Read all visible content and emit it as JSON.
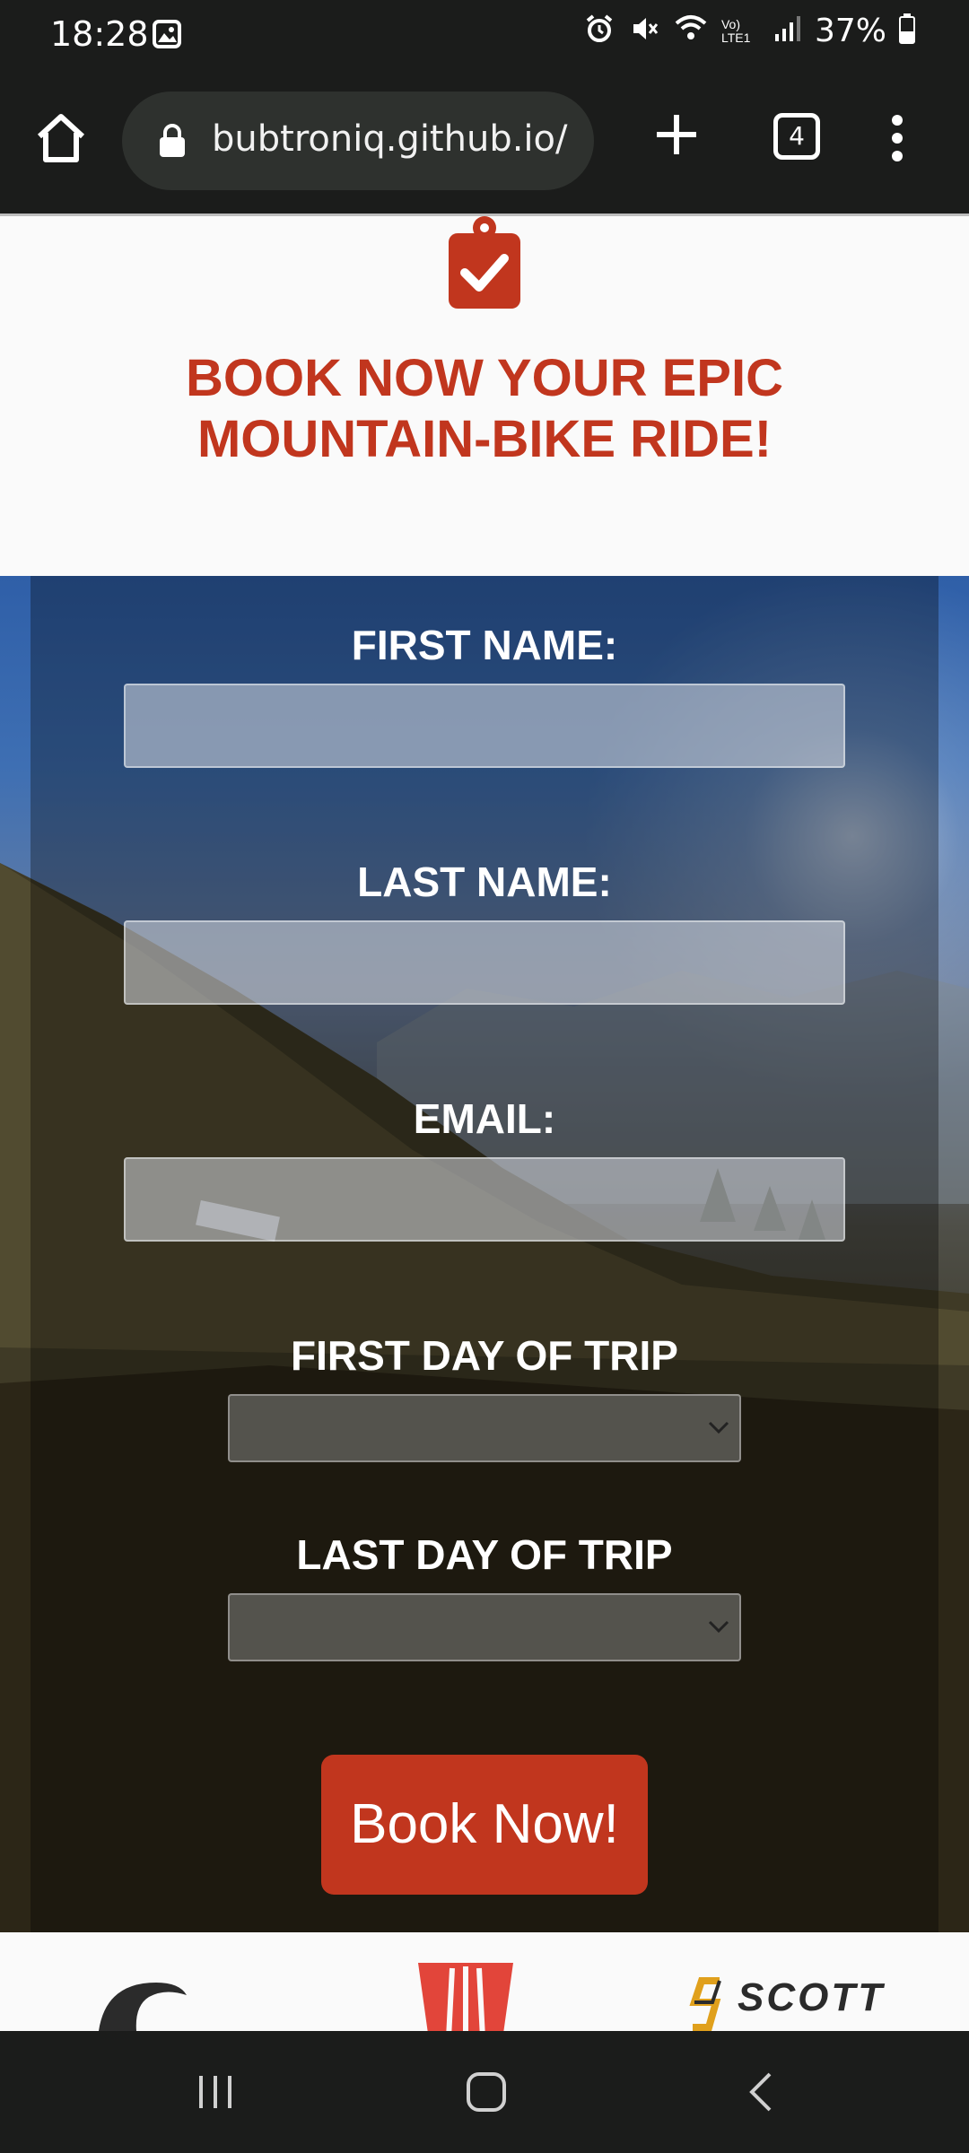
{
  "status_bar": {
    "time": "18:28",
    "battery": "37%",
    "network_label": "Vo) LTE1"
  },
  "browser": {
    "url": "bubtroniq.github.io/",
    "tab_count": "4"
  },
  "page": {
    "headline": "BOOK NOW YOUR EPIC MOUNTAIN-BIKE RIDE!",
    "accent_color": "#c1361e",
    "form": {
      "first_name_label": "FIRST NAME:",
      "first_name_value": "",
      "last_name_label": "LAST NAME:",
      "last_name_value": "",
      "email_label": "EMAIL:",
      "email_value": "",
      "first_day_label": "FIRST DAY OF TRIP",
      "first_day_value": "",
      "last_day_label": "LAST DAY OF TRIP",
      "last_day_value": "",
      "submit_label": "Book Now!"
    },
    "brand_logos": [
      "cannondale-logo",
      "trek-logo",
      "scott-logo"
    ],
    "scott_text": "SCOTT"
  },
  "icons": {
    "home": "home-icon",
    "lock": "lock-icon",
    "new_tab": "plus-icon",
    "menu": "more-vert-icon",
    "clipboard": "clipboard-check-icon"
  }
}
